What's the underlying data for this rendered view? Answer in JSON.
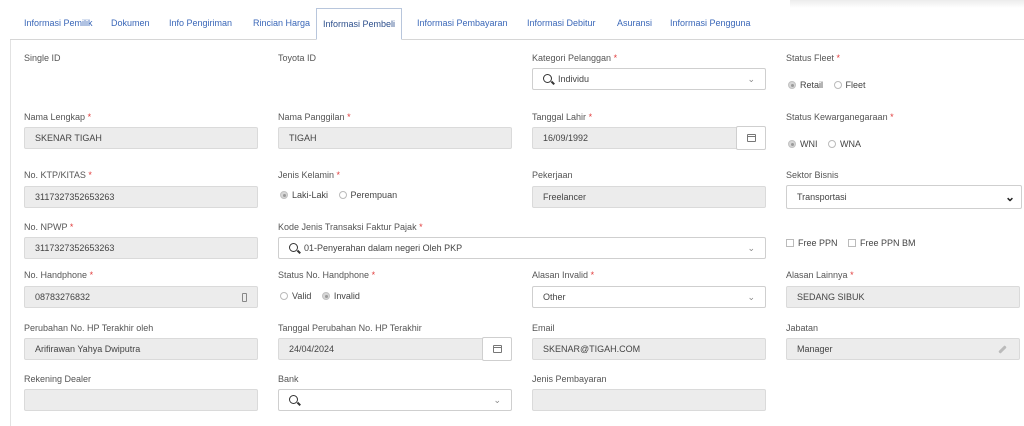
{
  "tabs": [
    {
      "label": "Informasi Pemilik"
    },
    {
      "label": "Dokumen"
    },
    {
      "label": "Info Pengiriman"
    },
    {
      "label": "Rincian Harga"
    },
    {
      "label": "Informasi Pembeli"
    },
    {
      "label": "Informasi Pembayaran"
    },
    {
      "label": "Informasi Debitur"
    },
    {
      "label": "Asuransi"
    },
    {
      "label": "Informasi Pengguna"
    }
  ],
  "active_tab": "Informasi Pembeli",
  "form": {
    "single_id": {
      "label": "Single ID"
    },
    "toyota_id": {
      "label": "Toyota ID"
    },
    "kategori": {
      "label": "Kategori Pelanggan",
      "value": "Individu"
    },
    "status_fleet": {
      "label": "Status Fleet",
      "options": [
        "Retail",
        "Fleet"
      ],
      "selected": "Retail"
    },
    "nama_lengkap": {
      "label": "Nama Lengkap",
      "value": "SKENAR TIGAH"
    },
    "nama_panggilan": {
      "label": "Nama Panggilan",
      "value": "TIGAH"
    },
    "tanggal_lahir": {
      "label": "Tanggal Lahir",
      "value": "16/09/1992"
    },
    "kewarganegaraan": {
      "label": "Status Kewarganegaraan",
      "options": [
        "WNI",
        "WNA"
      ],
      "selected": "WNI"
    },
    "ktp": {
      "label": "No. KTP/KITAS",
      "value": "3117327352653263"
    },
    "jenis_kelamin": {
      "label": "Jenis Kelamin",
      "options": [
        "Laki-Laki",
        "Perempuan"
      ],
      "selected": "Laki-Laki"
    },
    "pekerjaan": {
      "label": "Pekerjaan",
      "value": "Freelancer"
    },
    "sektor_bisnis": {
      "label": "Sektor Bisnis",
      "value": "Transportasi"
    },
    "npwp": {
      "label": "No. NPWP",
      "value": "3117327352653263"
    },
    "kode_faktur": {
      "label": "Kode Jenis Transaksi Faktur Pajak",
      "value": "01-Penyerahan dalam negeri Oleh PKP"
    },
    "free_ppn": {
      "label": "Free PPN"
    },
    "free_ppn_bm": {
      "label": "Free PPN BM"
    },
    "handphone": {
      "label": "No. Handphone",
      "value": "08783276832"
    },
    "status_hp": {
      "label": "Status No. Handphone",
      "options": [
        "Valid",
        "Invalid"
      ],
      "selected": "Invalid"
    },
    "alasan_invalid": {
      "label": "Alasan Invalid",
      "value": "Other"
    },
    "alasan_lainnya": {
      "label": "Alasan Lainnya",
      "value": "SEDANG SIBUK"
    },
    "perubahan_oleh": {
      "label": "Perubahan No. HP Terakhir oleh",
      "value": "Arifirawan Yahya Dwiputra"
    },
    "tanggal_perubahan": {
      "label": "Tanggal Perubahan No. HP Terakhir",
      "value": "24/04/2024"
    },
    "email": {
      "label": "Email",
      "value": "SKENAR@TIGAH.COM"
    },
    "jabatan": {
      "label": "Jabatan",
      "value": "Manager"
    },
    "rekening": {
      "label": "Rekening Dealer"
    },
    "bank": {
      "label": "Bank"
    },
    "jenis_pembayaran": {
      "label": "Jenis Pembayaran"
    }
  },
  "required_mark": "*",
  "icons": {
    "search": "search-icon",
    "chevron": "chevron-down-icon",
    "calendar": "calendar-icon",
    "phone": "phone-icon",
    "pencil": "pencil-icon"
  }
}
